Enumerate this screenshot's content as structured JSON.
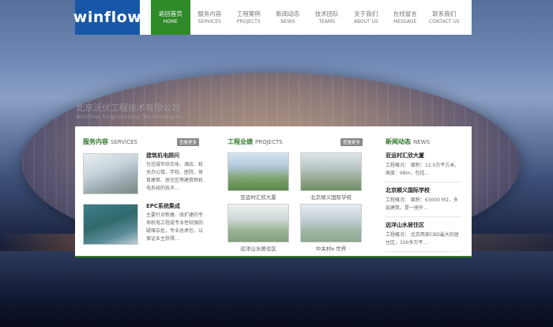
{
  "logo": "winflow",
  "nav": {
    "items": [
      {
        "cn": "返回首页",
        "en": "HOME"
      },
      {
        "cn": "服务内容",
        "en": "SERVICES"
      },
      {
        "cn": "工程案例",
        "en": "PROJECTS"
      },
      {
        "cn": "新闻动态",
        "en": "NEWS"
      },
      {
        "cn": "技术团队",
        "en": "TEAMS"
      },
      {
        "cn": "关于我们",
        "en": "ABOUT US"
      },
      {
        "cn": "在线留言",
        "en": "MESSAGE"
      },
      {
        "cn": "联系我们",
        "en": "CONTACT US"
      }
    ]
  },
  "watermark": {
    "cn": "北京沃伏工程技术有限公司",
    "en": "Winflow Engineering Technologies"
  },
  "services": {
    "title_cn": "服务内容",
    "title_en": "SERVICES",
    "more": "查看更多",
    "items": [
      {
        "title": "建筑机电顾问",
        "text": "包括城市综合体、酒店、机关办公楼、学校、医院、体育建筑、居住区等建筑物机电系统的技术..."
      },
      {
        "title": "EPC系统集成",
        "text": "主要针对新建、改扩建的专项机电工程或专业性较强的疑难杂症，专业总承包，以保证业主获得..."
      }
    ]
  },
  "projects": {
    "title_cn": "工程业绩",
    "title_en": "PROJECTS",
    "more": "查看更多",
    "items": [
      {
        "caption": "亚运村汇欣大厦"
      },
      {
        "caption": "北京顺义国际学校"
      },
      {
        "caption": "远洋山水居住区"
      },
      {
        "caption": "中关村e 世界"
      }
    ]
  },
  "news": {
    "title_cn": "新闻动态",
    "title_en": "NEWS",
    "items": [
      {
        "title": "亚运村汇欣大厦",
        "text": "工程概况： 面积：12.0万平方米，高度：98m，包括..."
      },
      {
        "title": "北京顺义国际学校",
        "text": "工程概况： 面积：63000 M2，多层建筑，是一座外..."
      },
      {
        "title": "远洋山水居住区",
        "text": "工程概况： 北京西部CBD最大的居住区，100多万平..."
      }
    ]
  }
}
